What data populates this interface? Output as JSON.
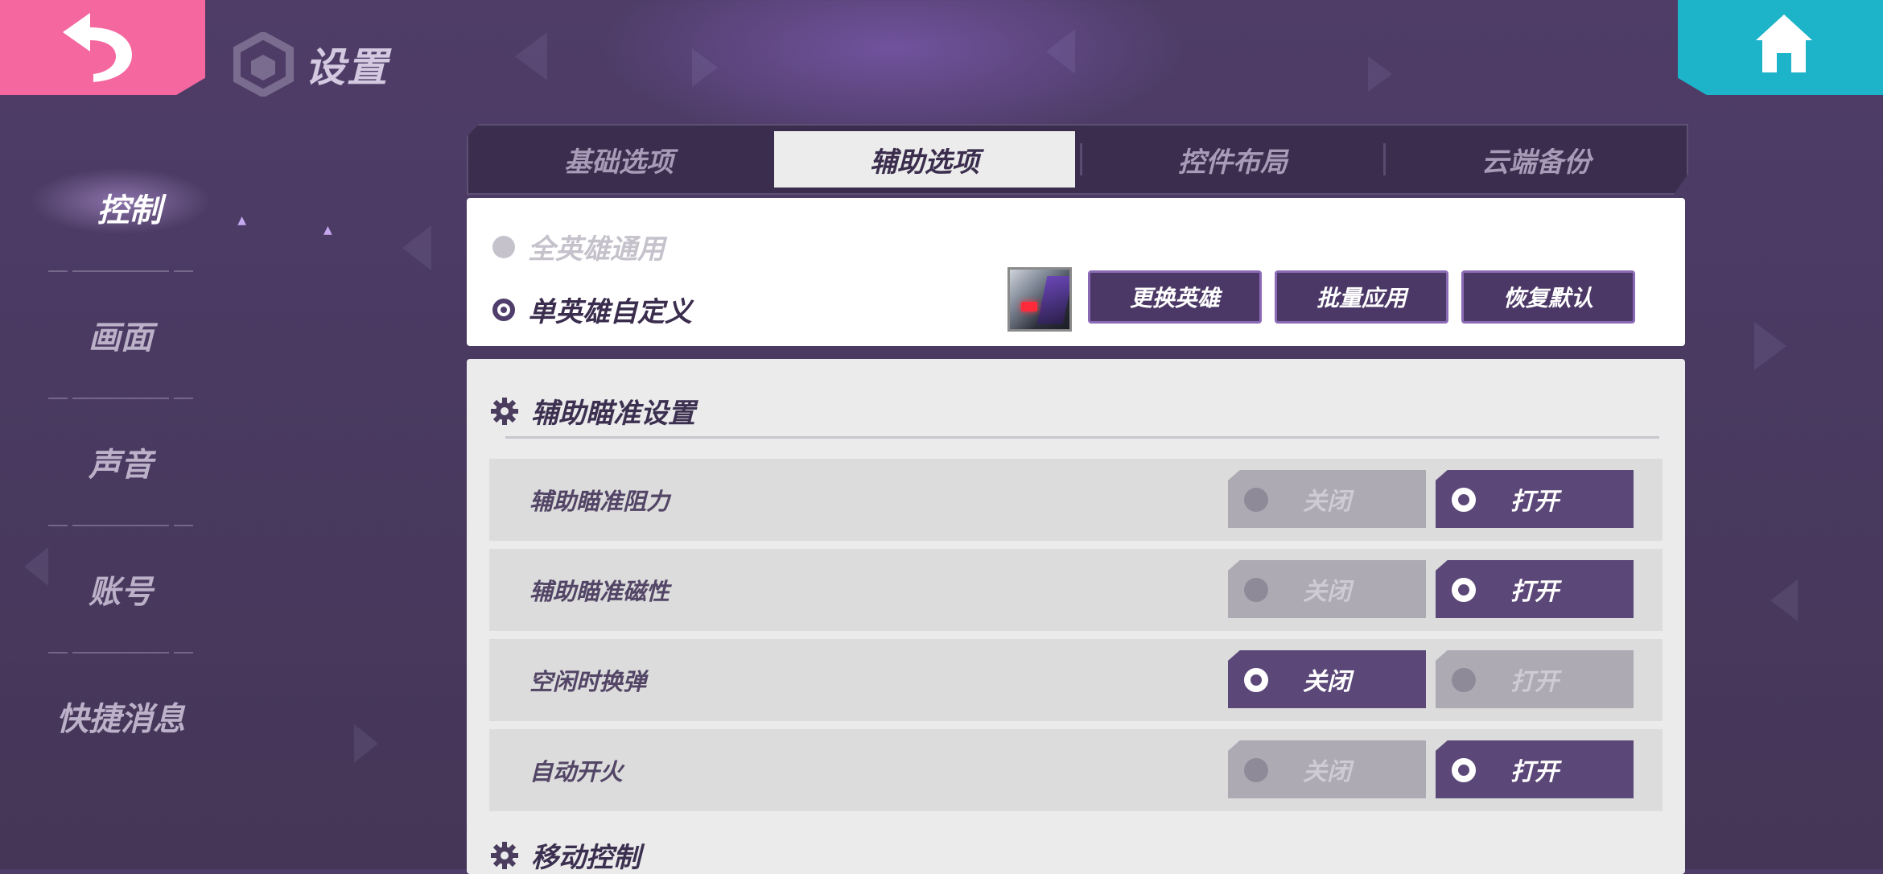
{
  "header": {
    "title": "设置",
    "back_icon": "back-arrow-icon",
    "home_icon": "home-icon"
  },
  "sidebar": {
    "items": [
      {
        "label": "控制",
        "active": true
      },
      {
        "label": "画面",
        "active": false
      },
      {
        "label": "声音",
        "active": false
      },
      {
        "label": "账号",
        "active": false
      },
      {
        "label": "快捷消息",
        "active": false
      }
    ]
  },
  "tabs": [
    {
      "label": "基础选项",
      "active": false
    },
    {
      "label": "辅助选项",
      "active": true
    },
    {
      "label": "控件布局",
      "active": false
    },
    {
      "label": "云端备份",
      "active": false
    }
  ],
  "hero_mode": {
    "options": [
      {
        "label": "全英雄通用",
        "selected": false
      },
      {
        "label": "单英雄自定义",
        "selected": true
      }
    ],
    "buttons": {
      "change_hero": "更换英雄",
      "batch_apply": "批量应用",
      "restore_default": "恢复默认"
    }
  },
  "sections": {
    "aim_assist": {
      "title": "辅助瞄准设置",
      "rows": [
        {
          "label": "辅助瞄准阻力",
          "off_label": "关闭",
          "on_label": "打开",
          "value": "on"
        },
        {
          "label": "辅助瞄准磁性",
          "off_label": "关闭",
          "on_label": "打开",
          "value": "on"
        },
        {
          "label": "空闲时换弹",
          "off_label": "关闭",
          "on_label": "打开",
          "value": "off"
        },
        {
          "label": "自动开火",
          "off_label": "关闭",
          "on_label": "打开",
          "value": "on"
        }
      ]
    },
    "movement": {
      "title": "移动控制"
    }
  },
  "colors": {
    "back_button": "#f4679f",
    "home_button": "#1db4c9",
    "toggle_on": "#5c4878",
    "toggle_off": "#aeaab3"
  }
}
